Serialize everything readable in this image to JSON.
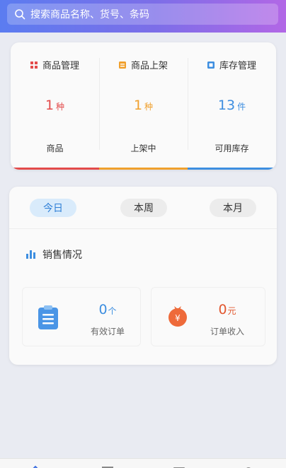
{
  "search": {
    "placeholder": "搜索商品名称、货号、条码"
  },
  "overview": {
    "columns": [
      {
        "title": "商品管理",
        "value": "1",
        "unit": "种",
        "label": "商品",
        "color": "#e34a4a",
        "icon": "grid-icon"
      },
      {
        "title": "商品上架",
        "value": "1",
        "unit": "种",
        "label": "上架中",
        "color": "#f0a02d",
        "icon": "shelf-icon"
      },
      {
        "title": "库存管理",
        "value": "13",
        "unit": "件",
        "label": "可用库存",
        "color": "#3d8ee0",
        "icon": "inventory-icon"
      }
    ]
  },
  "sales": {
    "tabs": [
      {
        "label": "今日",
        "active": true
      },
      {
        "label": "本周",
        "active": false
      },
      {
        "label": "本月",
        "active": false
      }
    ],
    "title": "销售情况",
    "stats": [
      {
        "value": "0",
        "unit": "个",
        "label": "有效订单",
        "color": "#3d8ee0",
        "icon": "order-clipboard-icon"
      },
      {
        "value": "0",
        "unit": "元",
        "label": "订单收入",
        "color": "#e2572f",
        "icon": "money-bag-icon"
      }
    ]
  },
  "colors": {
    "header_start": "#5b7cf0",
    "header_end": "#b267e6",
    "red": "#e34a4a",
    "orange": "#f0a02d",
    "blue": "#3d8ee0"
  }
}
